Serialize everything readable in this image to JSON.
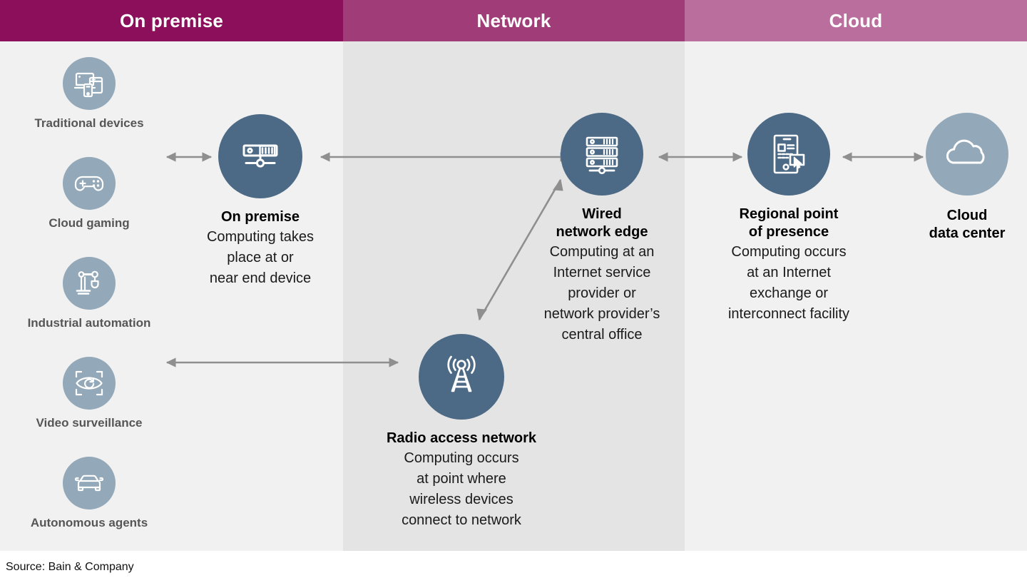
{
  "bands": [
    {
      "id": "on-premise",
      "label": "On premise",
      "header_color": "#8b0f5b",
      "body_color": "#f1f1f1"
    },
    {
      "id": "network",
      "label": "Network",
      "header_color": "#a03d79",
      "body_color": "#e4e4e4"
    },
    {
      "id": "cloud",
      "label": "Cloud",
      "header_color": "#ba6e9e",
      "body_color": "#f1f1f1"
    }
  ],
  "devices": [
    {
      "label": "Traditional devices",
      "icon": "devices-icon"
    },
    {
      "label": "Cloud gaming",
      "icon": "gamepad-icon"
    },
    {
      "label": "Industrial automation",
      "icon": "robot-arm-icon"
    },
    {
      "label": "Video surveillance",
      "icon": "eye-scan-icon"
    },
    {
      "label": "Autonomous agents",
      "icon": "car-icon"
    }
  ],
  "nodes": {
    "on_premise": {
      "title": "On premise",
      "desc": "Computing takes\nplace at or\nnear end device",
      "icon": "server-unit-icon",
      "circle_color": "#4c6a85"
    },
    "radio_access_network": {
      "title": "Radio access network",
      "desc": "Computing occurs\nat point where\nwireless devices\nconnect to network",
      "icon": "radio-tower-icon",
      "circle_color": "#4c6a85"
    },
    "wired_network_edge": {
      "title": "Wired\nnetwork edge",
      "desc": "Computing at an\nInternet service\nprovider or\nnetwork provider’s\ncentral office",
      "icon": "server-rack-icon",
      "circle_color": "#4c6a85"
    },
    "regional_pop": {
      "title": "Regional point\nof presence",
      "desc": "Computing occurs\nat an Internet\nexchange or\ninterconnect facility",
      "icon": "tablet-cursor-icon",
      "circle_color": "#4c6a85"
    },
    "cloud_data_center": {
      "title": "Cloud\ndata center",
      "desc": "",
      "icon": "cloud-icon",
      "circle_color": "#93a8b8"
    }
  },
  "connections": [
    {
      "from": "devices",
      "to": "on_premise",
      "style": "double"
    },
    {
      "from": "on_premise",
      "to": "wired_network_edge",
      "style": "double"
    },
    {
      "from": "devices",
      "to": "radio_access_network",
      "style": "double"
    },
    {
      "from": "radio_access_network",
      "to": "wired_network_edge",
      "style": "double"
    },
    {
      "from": "wired_network_edge",
      "to": "regional_pop",
      "style": "double"
    },
    {
      "from": "regional_pop",
      "to": "cloud_data_center",
      "style": "double"
    }
  ],
  "footer": {
    "source": "Source: Bain & Company"
  },
  "colors": {
    "arrow": "#8f8f8f",
    "device_label": "#565656",
    "node_text": "#000000"
  }
}
